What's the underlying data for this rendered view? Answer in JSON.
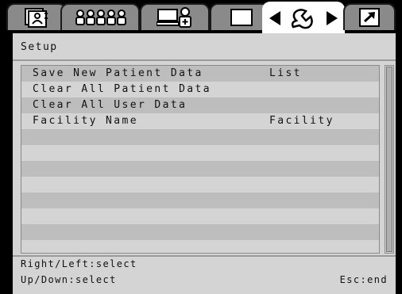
{
  "tabs": [
    {
      "icon": "patient-record-icon",
      "active": false
    },
    {
      "icon": "patient-list-icon",
      "active": false
    },
    {
      "icon": "user-computer-icon",
      "active": false
    },
    {
      "icon": "blank-screen-icon",
      "active": false
    },
    {
      "icon": "wrench-settings-icon",
      "active": true
    },
    {
      "icon": "export-arrow-icon",
      "active": false
    }
  ],
  "panel": {
    "title": "Setup"
  },
  "settings": [
    {
      "label": "Save New Patient Data",
      "value": "List"
    },
    {
      "label": "Clear All Patient Data",
      "value": ""
    },
    {
      "label": "Clear All User Data",
      "value": ""
    },
    {
      "label": "Facility Name",
      "value": "Facility"
    }
  ],
  "footer": {
    "hint_left_right": "Right/Left:select",
    "hint_up_down": "Up/Down:select",
    "hint_escape": "Esc:end"
  },
  "colors": {
    "panel_bg": "#d4d4d4",
    "tab_inactive": "#8a8a8a",
    "tab_active": "#ffffff",
    "row_alt": "#bdbdbd"
  }
}
